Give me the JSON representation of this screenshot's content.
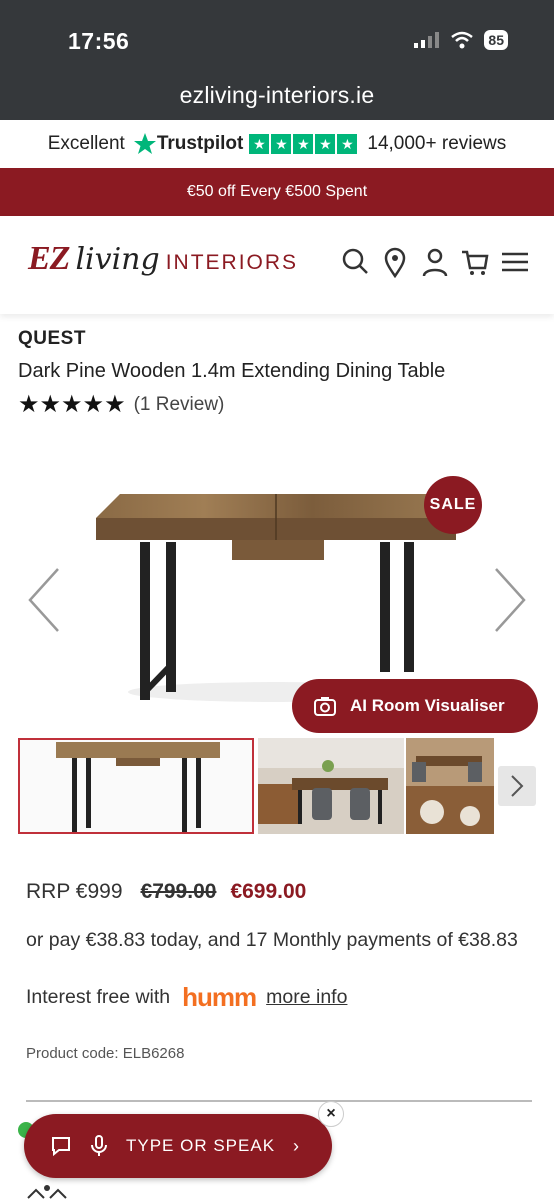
{
  "status_bar": {
    "time": "17:56",
    "battery": "85"
  },
  "browser": {
    "url": "ezliving-interiors.ie"
  },
  "trustpilot": {
    "rating_word": "Excellent",
    "brand": "Trustpilot",
    "reviews": "14,000+ reviews",
    "star_color": "#00b67a"
  },
  "promo": {
    "text": "€50 off Every €500 Spent"
  },
  "header": {
    "logo_ez": "EZ",
    "logo_living": "living",
    "logo_interiors": "INTERIORS",
    "icons": [
      "search-icon",
      "location-pin-icon",
      "account-icon",
      "cart-icon",
      "menu-icon"
    ]
  },
  "product": {
    "brand": "QUEST",
    "title": "Dark Pine Wooden 1.4m Extending Dining Table",
    "stars": "★★★★★",
    "rating_value": 5,
    "review_count": "(1 Review)",
    "sale_badge": "SALE",
    "ai_visualiser": "AI Room Visualiser",
    "rrp": "RRP €999",
    "was_price": "€799.00",
    "now_price": "€699.00",
    "finance_text": "or pay €38.83 today, and 17 Monthly payments of €38.83",
    "interest_free": "Interest free with",
    "humm": "humm",
    "more_info": "more info",
    "product_code": "Product code: ELB6268"
  },
  "voice_widget": {
    "label": "TYPE OR SPEAK",
    "chevron": "›",
    "close": "×"
  },
  "colors": {
    "brand_red": "#8b1a22",
    "price_red": "#8b1a22",
    "humm_orange": "#f36f21"
  }
}
